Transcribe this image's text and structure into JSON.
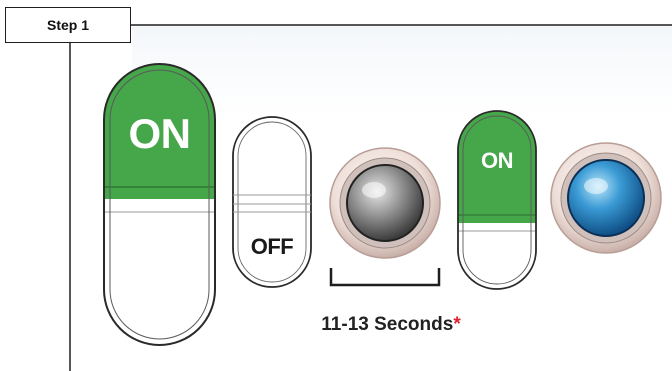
{
  "step": {
    "label": "Step 1"
  },
  "switches": [
    {
      "id": "big-switch",
      "state_label": "ON",
      "state": "on",
      "color": "#45a64a"
    },
    {
      "id": "off-switch",
      "state_label": "OFF",
      "state": "off"
    },
    {
      "id": "small-switch",
      "state_label": "ON",
      "state": "on",
      "color": "#45a64a"
    }
  ],
  "lights": [
    {
      "id": "light-off",
      "lens": "gray",
      "color": "#8a8a8a"
    },
    {
      "id": "light-on",
      "lens": "blue",
      "color": "#2f8fc8"
    }
  ],
  "timer": {
    "duration": "11-13 Seconds",
    "footnote_mark": "*",
    "footnote_color": "#e0202a"
  },
  "colors": {
    "switch_green": "#45a64a",
    "outline": "#2a2a2a",
    "rim": "#e8d8d2"
  }
}
